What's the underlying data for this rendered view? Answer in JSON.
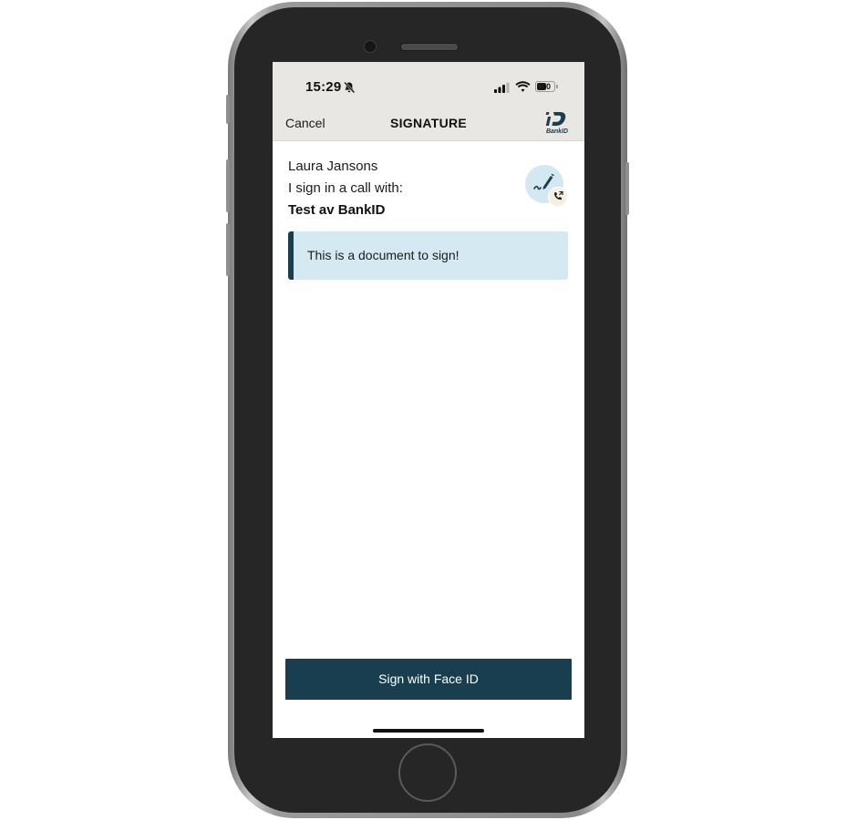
{
  "status_bar": {
    "time": "15:29",
    "battery_level": "50"
  },
  "nav": {
    "cancel_label": "Cancel",
    "title": "SIGNATURE",
    "logo_text": "BankID"
  },
  "info": {
    "name": "Laura Jansons",
    "context": "I sign in a call with:",
    "party": "Test av BankID"
  },
  "document": {
    "text": "This is a document to sign!"
  },
  "actions": {
    "sign_label": "Sign with Face ID"
  },
  "colors": {
    "accent": "#193e4f",
    "card_bg": "#d4e9f2",
    "header_bg": "#e8e7e3"
  }
}
